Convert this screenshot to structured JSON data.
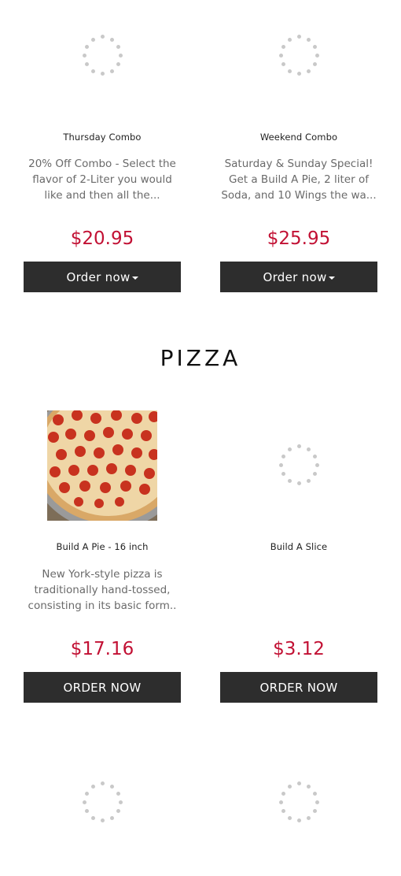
{
  "combos": [
    {
      "name": "Thursday Combo",
      "description": "20% Off Combo - Select the flavor of 2-Liter you would like and then all the...",
      "price": "$20.95",
      "button_label": "Order now",
      "button_icon": "caret-down-icon",
      "image": "loading-spinner"
    },
    {
      "name": "Weekend Combo",
      "description": "Saturday & Sunday Special! Get a Build A Pie, 2 liter of Soda, and 10 Wings the wa...",
      "price": "$25.95",
      "button_label": "Order now",
      "button_icon": "caret-down-icon",
      "image": "loading-spinner"
    }
  ],
  "pizza_section": {
    "title": "PIZZA",
    "items": [
      {
        "name": "Build A Pie - 16 inch",
        "description": "New York-style pizza is traditionally hand-tossed, consisting in its basic form..",
        "price": "$17.16",
        "button_label": "ORDER NOW",
        "image": "pepperoni-pizza-photo"
      },
      {
        "name": "Build A Slice",
        "description": "",
        "price": "$3.12",
        "button_label": "ORDER NOW",
        "image": "loading-spinner"
      }
    ]
  },
  "colors": {
    "price": "#c21134",
    "button_bg": "#2d2d2d",
    "button_text": "#ffffff",
    "description": "#6a6a6a",
    "spinner": "#c9c9c9"
  }
}
